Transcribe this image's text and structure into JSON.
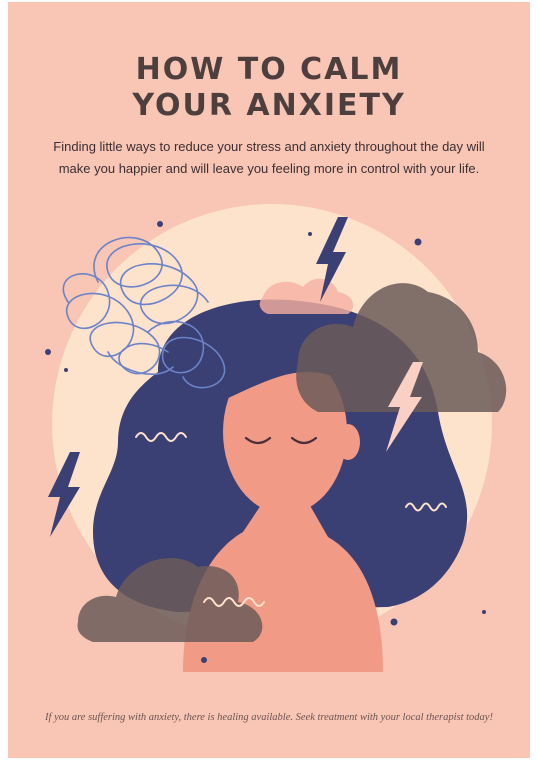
{
  "title": {
    "line1": "HOW TO CALM",
    "line2": "YOUR ANXIETY"
  },
  "subtitle": {
    "line1": "Finding little ways to reduce your stress and anxiety throughout the day will",
    "line2": "make you happier and will leave you feeling more in control with your life."
  },
  "illustration": {
    "icons": [
      "lightning-bolt-icon",
      "scribble-icon",
      "storm-cloud-icon",
      "wave-icon",
      "closed-eyes-icon"
    ]
  },
  "footer": {
    "text": "If you are suffering with anxiety, there is healing available. Seek treatment with your local therapist today!"
  },
  "colors": {
    "background": "#f9c5b4",
    "circle": "#fde2cc",
    "hair": "#3a3f74",
    "skin": "#f19a86",
    "cloud": "#6b5b58",
    "scribble": "#6b83c9",
    "bolt": "#3a3f74",
    "title": "#4e3f3f"
  }
}
